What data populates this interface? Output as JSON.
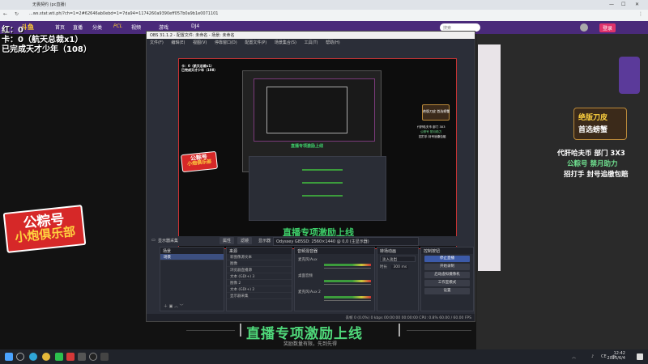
{
  "browser": {
    "tab_title": "无畏契约 (pc直播)",
    "url": "...ws.stat.wti.ph/?ch=1=2#62646ab0ebd=1=7da94=1174260a9390eff057b0a9b1e0071101",
    "search_placeholder": "搜索"
  },
  "site_nav": {
    "logo": "斗鱼",
    "items": [
      "首页",
      "直播",
      "分类",
      "PCL",
      "视频",
      "游戏",
      "DJ4"
    ],
    "user_bar": "登录"
  },
  "overlay": {
    "line1": "红：0",
    "line2": "卡：0（航天总裁x1）",
    "line3": "已完成天才少年（108）"
  },
  "sticker": {
    "top": "公粽号",
    "bottom": "小炮俱乐部"
  },
  "obs": {
    "title": "OBS 31.1.2 - 配置文件: 未命名 - 场景: 未命名",
    "menu": [
      "文件(F)",
      "编辑(E)",
      "视图(V)",
      "停靠窗口(D)",
      "配置文件(P)",
      "场景集合(S)",
      "工具(T)",
      "帮助(H)"
    ],
    "toolbar": {
      "source_label": "显示器采集",
      "props": "属性",
      "filters": "滤镜",
      "display_label": "显示器",
      "display_value": "Odyssey G85SD: 2560×1440 @ 0,0 (主显示器)"
    },
    "docks": {
      "scenes": {
        "title": "场景",
        "items": [
          "场景"
        ]
      },
      "sources": {
        "title": "来源",
        "items": [
          "新图像源文本",
          "图像",
          "浏览器直播源",
          "文本 (GDI+) 3",
          "图像 2",
          "文本 (GDI+) 2",
          "显示器采集"
        ]
      },
      "mixer": {
        "title": "音频混音器",
        "channels": [
          "麦克风/Aux",
          "桌面音频",
          "麦克风/Aux 2"
        ]
      },
      "transitions": {
        "title": "转场动画",
        "type": "淡入淡出",
        "duration_label": "时长",
        "duration": "300 ms"
      },
      "controls": {
        "title": "控制按钮",
        "buttons": [
          "停止直播",
          "开始录制",
          "启动虚拟摄像机",
          "工作室模式",
          "设置",
          "退出"
        ]
      }
    },
    "status": "丢帧 0 (0.0%)   0 kbps   00:00:00   00:00:00   CPU: 0.8%   60.00 / 60.00 FPS"
  },
  "preview_inner": {
    "banner": "直播专项激励上线",
    "sub": "奖励数量有限，先到先得",
    "side_title": "绝版刀皮 首选螃蟹",
    "promo": [
      "代肝哈夫币 部门 3X3",
      "公粽号 禁月助力",
      "招打手 封号追缴包赔"
    ]
  },
  "promo_right": {
    "badge_line1": "绝版刀皮",
    "badge_line2": "首选螃蟹",
    "line1": "代肝哈夫币 部门 3X3",
    "line2": "公粽号  禁月助力",
    "line3": "招打手  封号追缴包赔"
  },
  "bottom_banner": {
    "title": "直播专项激励上线",
    "sub": "奖励数量有限，先到先得"
  },
  "taskbar": {
    "time": "12:42",
    "date": "2025/6/4",
    "lang": "中",
    "tray": "CE"
  },
  "colors": {
    "nav_bg": "#4a2a7a",
    "banner_green": "#4fd87a",
    "sticker_red": "#d62828",
    "obs_bg": "#2b2e38",
    "primary_btn": "#3c5aa8"
  }
}
